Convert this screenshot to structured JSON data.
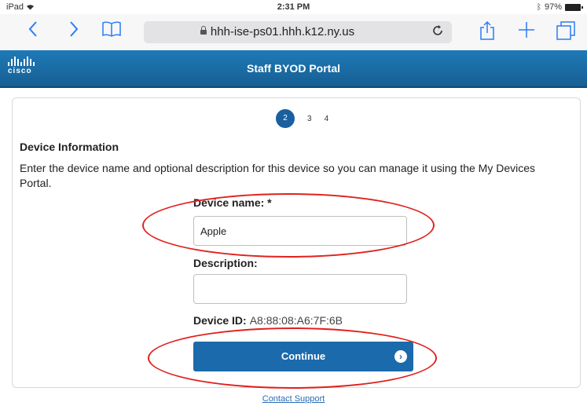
{
  "status_bar": {
    "device": "iPad",
    "time": "2:31 PM",
    "battery": "97%"
  },
  "browser": {
    "url": "hhh-ise-ps01.hhh.k12.ny.us",
    "back_icon": "chevron-left-icon",
    "forward_icon": "chevron-right-icon",
    "bookmarks_icon": "book-icon",
    "reload_icon": "reload-icon",
    "share_icon": "share-icon",
    "new_tab_icon": "plus-icon",
    "tabs_icon": "tabs-icon"
  },
  "header": {
    "logo_text": "cisco",
    "title": "Staff BYOD Portal",
    "color": "#1a6aa6"
  },
  "steps": {
    "active": "2",
    "others": [
      "3",
      "4"
    ]
  },
  "form": {
    "section_title": "Device Information",
    "instructions": "Enter the device name and optional description for this device so you can manage it using the My Devices Portal.",
    "device_name_label": "Device name: *",
    "device_name_value": "Apple",
    "description_label": "Description:",
    "description_value": "",
    "device_id_label": "Device ID:",
    "device_id_value": "A8:88:08:A6:7F:6B",
    "continue_label": "Continue"
  },
  "footer": {
    "support_link": "Contact Support"
  },
  "colors": {
    "accent": "#1b6aac",
    "annotation": "#e0211d",
    "browser_blue": "#2a7cf6"
  }
}
